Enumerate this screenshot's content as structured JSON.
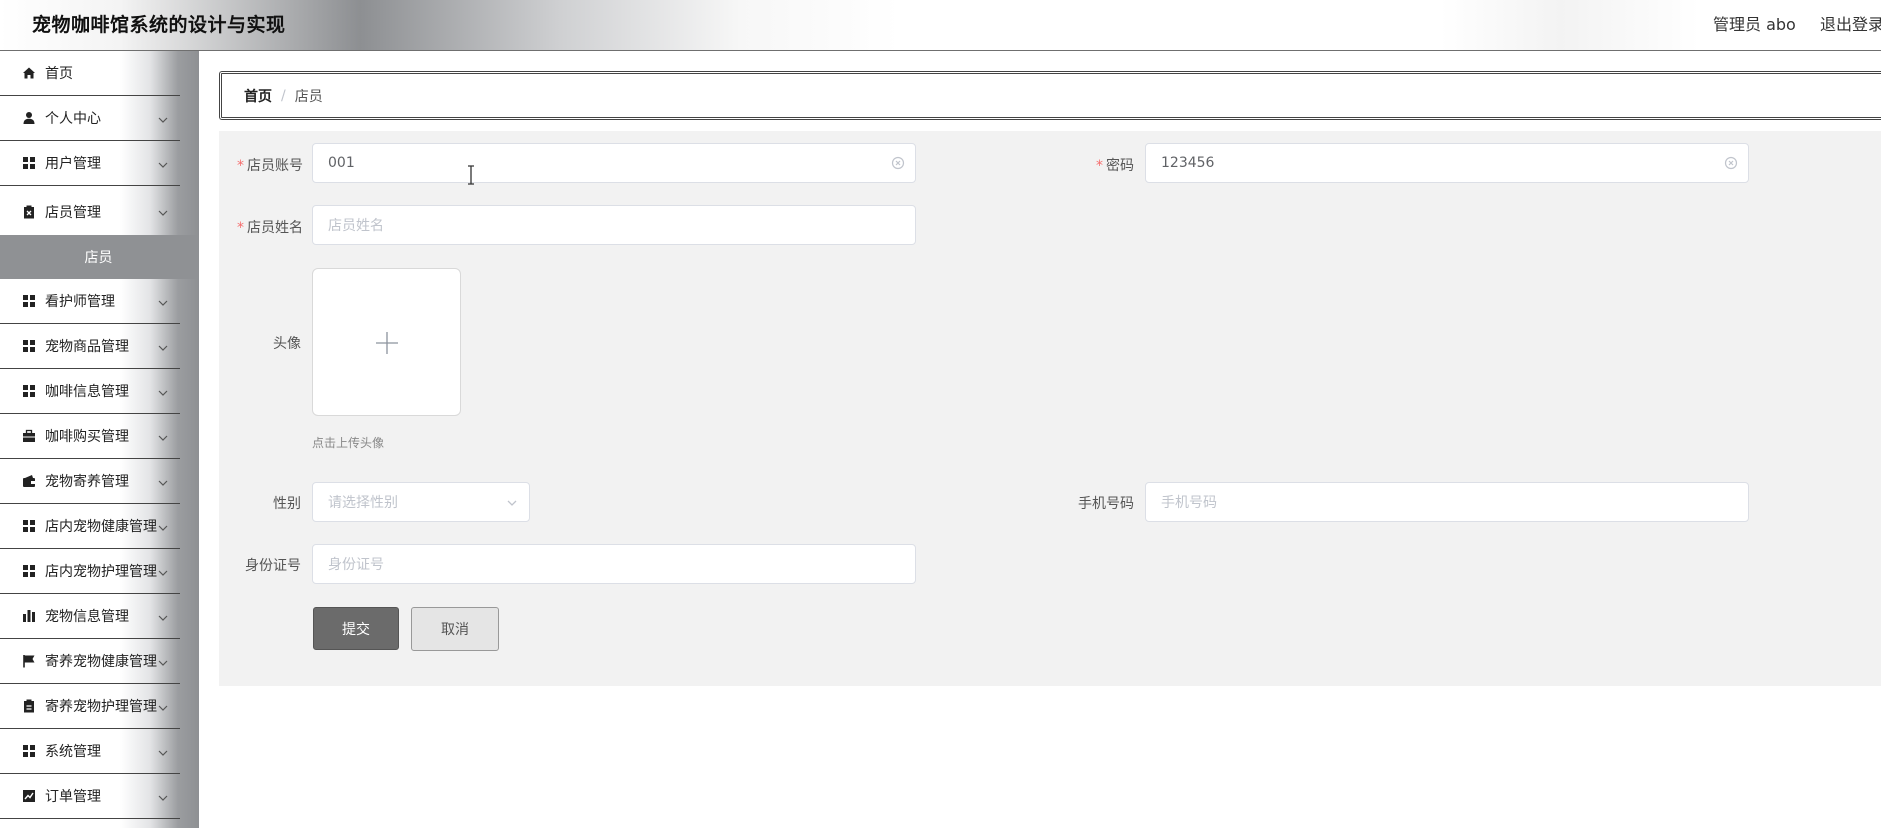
{
  "header": {
    "title": "宠物咖啡馆系统的设计与实现",
    "user": "管理员 abo",
    "logout": "退出登录"
  },
  "sidebar": {
    "items": [
      {
        "label": "首页",
        "icon": "home-icon",
        "arrow": false
      },
      {
        "label": "个人中心",
        "icon": "user-icon",
        "arrow": true
      },
      {
        "label": "用户管理",
        "icon": "grid-icon",
        "arrow": true
      },
      {
        "label": "店员管理",
        "icon": "clipboard-x-icon",
        "arrow": true
      },
      {
        "label": "看护师管理",
        "icon": "grid-icon",
        "arrow": true
      },
      {
        "label": "宠物商品管理",
        "icon": "grid-icon",
        "arrow": true
      },
      {
        "label": "咖啡信息管理",
        "icon": "grid-icon",
        "arrow": true
      },
      {
        "label": "咖啡购买管理",
        "icon": "briefcase-icon",
        "arrow": true
      },
      {
        "label": "宠物寄养管理",
        "icon": "wallet-icon",
        "arrow": true
      },
      {
        "label": "店内宠物健康管理",
        "icon": "grid-icon",
        "arrow": true
      },
      {
        "label": "店内宠物护理管理",
        "icon": "grid-icon",
        "arrow": true
      },
      {
        "label": "宠物信息管理",
        "icon": "bar-chart-icon",
        "arrow": true
      },
      {
        "label": "寄养宠物健康管理",
        "icon": "flag-icon",
        "arrow": true
      },
      {
        "label": "寄养宠物护理管理",
        "icon": "clipboard-icon",
        "arrow": true
      },
      {
        "label": "系统管理",
        "icon": "grid-icon",
        "arrow": true
      },
      {
        "label": "订单管理",
        "icon": "line-chart-icon",
        "arrow": true
      }
    ],
    "active_sub": "店员"
  },
  "breadcrumb": {
    "home": "首页",
    "separator": "/",
    "current": "店员"
  },
  "form": {
    "account": {
      "label": "店员账号",
      "value": "001",
      "required": true
    },
    "password": {
      "label": "密码",
      "value": "123456",
      "required": true
    },
    "name": {
      "label": "店员姓名",
      "placeholder": "店员姓名",
      "required": true
    },
    "avatar": {
      "label": "头像",
      "tip": "点击上传头像"
    },
    "gender": {
      "label": "性别",
      "placeholder": "请选择性别"
    },
    "phone": {
      "label": "手机号码",
      "placeholder": "手机号码"
    },
    "idcard": {
      "label": "身份证号",
      "placeholder": "身份证号"
    },
    "submit": "提交",
    "cancel": "取消"
  },
  "colors": {
    "required": "#f56c6c",
    "submit_bg": "#6b6b6b",
    "panel_bg": "#f2f2f2",
    "sidebar_active_bg": "#8f9194"
  }
}
